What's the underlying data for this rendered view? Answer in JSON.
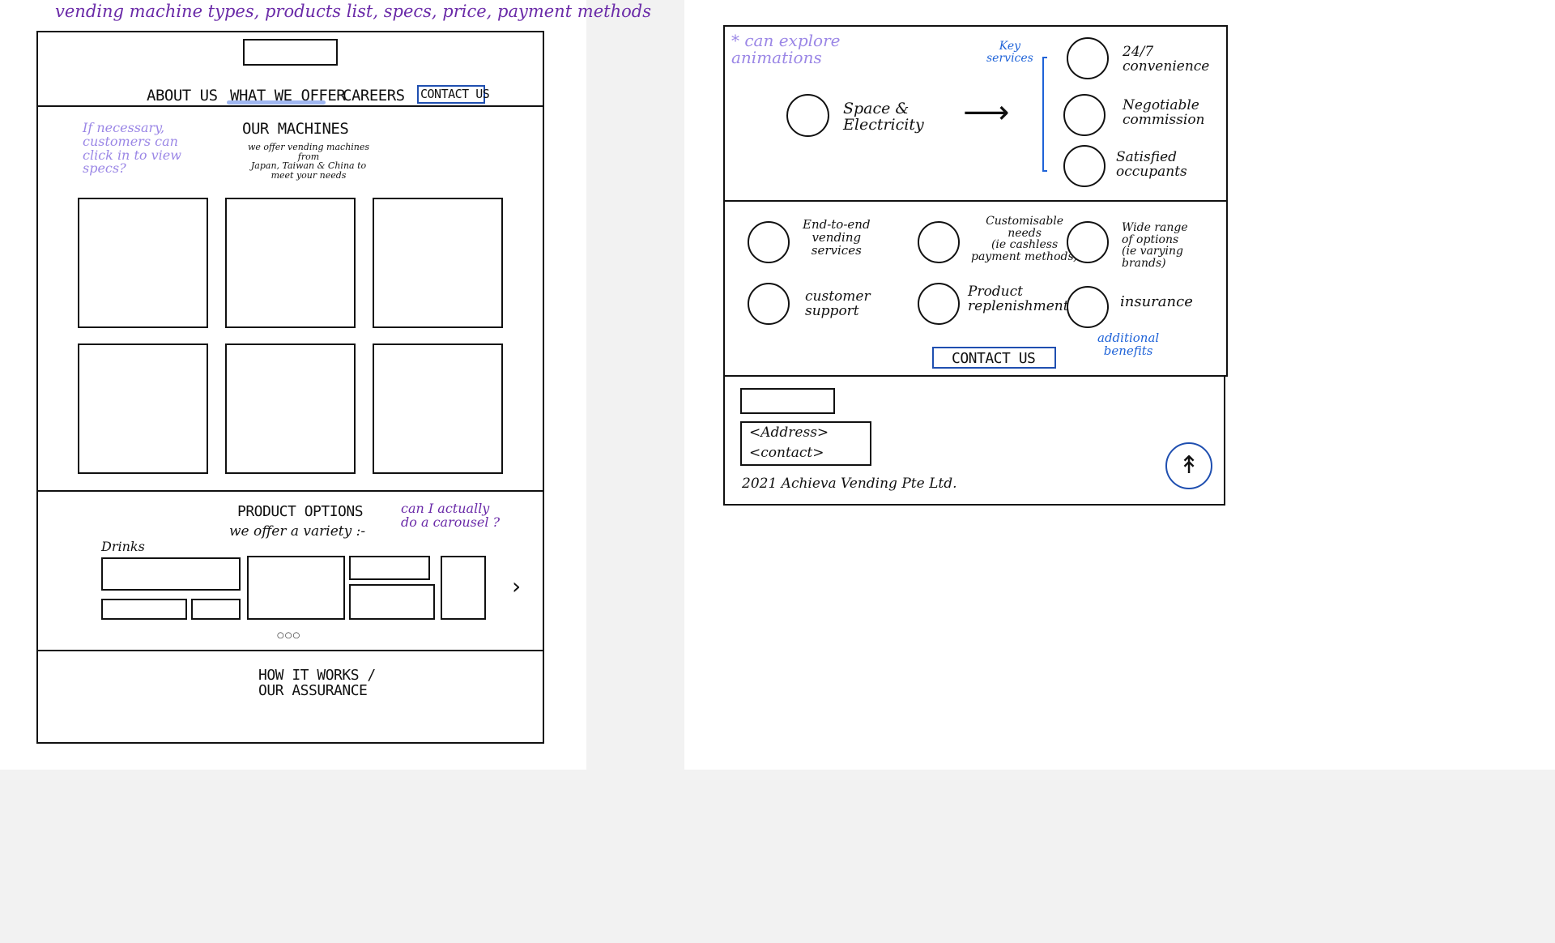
{
  "page_top_note": "vending machine types, products list, specs, price, payment methods",
  "left_page": {
    "nav": {
      "items": [
        "ABOUT US",
        "WHAT WE OFFER",
        "CAREERS"
      ],
      "contact_button": "CONTACT US"
    },
    "note_specs": "If necessary,\ncustomers can\nclick in to view\nspecs?",
    "machines": {
      "title": "OUR MACHINES",
      "subtitle": "we offer vending machines from\nJapan, Taiwan & China to\nmeet your needs"
    },
    "products": {
      "title": "PRODUCT OPTIONS",
      "subtitle": "we offer a variety :-",
      "note": "can I actually\ndo a carousel ?",
      "category": "Drinks",
      "next_arrow": "›",
      "pager": "○○○"
    },
    "how_it_works": "HOW IT WORKS /\nOUR ASSURANCE"
  },
  "right_page": {
    "note_animations": "* can explore\nanimations",
    "space_label": "Space &\nElectricity",
    "arrow": "⟶",
    "key_services_label": "Key\nservices",
    "key_services": [
      "24/7\nconvenience",
      "Negotiable\ncommission",
      "Satisfied\noccupants"
    ],
    "benefits": [
      "End-to-end\nvending\nservices",
      "Customisable\nneeds\n(ie cashless\npayment methods)",
      "Wide range\nof options\n(ie varying\nbrands)",
      "customer\nsupport",
      "Product\nreplenishment",
      "insurance"
    ],
    "contact_button": "CONTACT US",
    "additional_benefits_label": "additional\nbenefits",
    "footer": {
      "address": "<Address>",
      "contact": "<contact>",
      "copyright": "2021 Achieva Vending Pte Ltd.",
      "back_to_top_icon": "↟"
    }
  },
  "colors": {
    "annotation_purple": "#6a2aa8",
    "annotation_lilac": "#9b87e6",
    "annotation_blue": "#1f63d8",
    "ink": "#111111"
  }
}
